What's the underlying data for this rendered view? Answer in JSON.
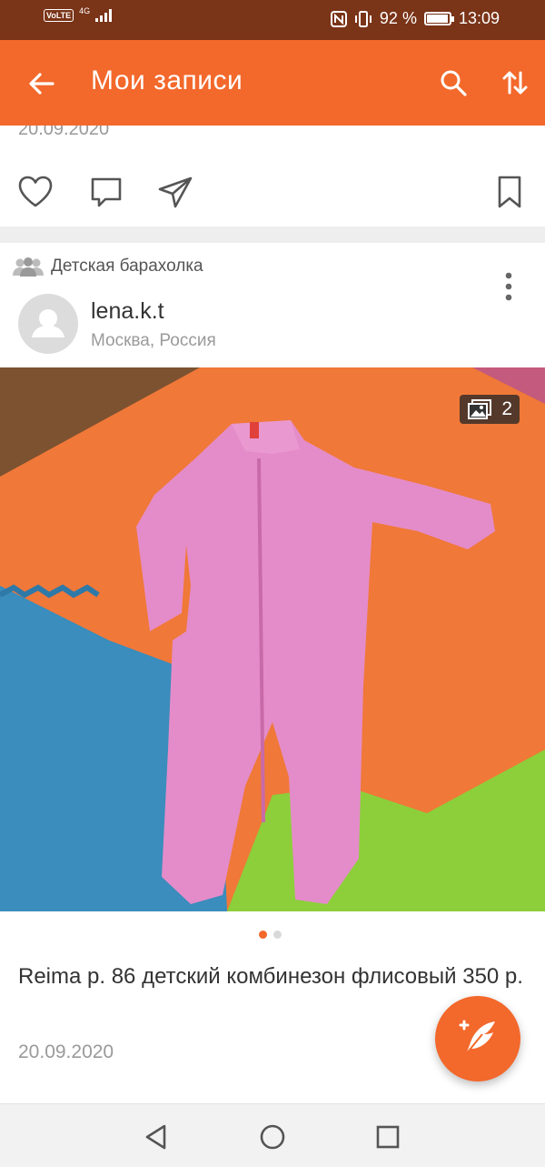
{
  "status_bar": {
    "volte": "VoLTE",
    "network": "4G",
    "battery": "92 %",
    "time": "13:09"
  },
  "app_bar": {
    "title": "Мои записи",
    "back_icon": "arrow-left-icon",
    "search_icon": "search-icon",
    "sort_icon": "sort-icon"
  },
  "previous_post": {
    "date": "20.09.2020"
  },
  "post": {
    "group": "Детская барахолка",
    "author": "lena.k.t",
    "location": "Москва, Россия",
    "photo_count": "2",
    "title": "Reima р. 86 детский комбинезон флисовый 350 р.",
    "date": "20.09.2020",
    "carousel_index": 1,
    "carousel_total": 2
  },
  "colors": {
    "accent": "#f3682b",
    "status_bar": "#7a3418"
  }
}
